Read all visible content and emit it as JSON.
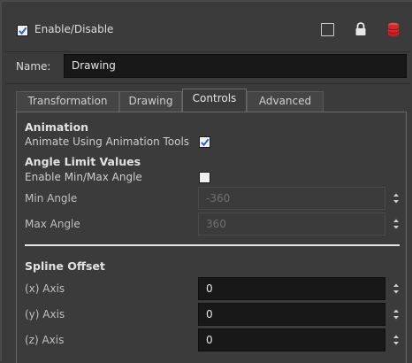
{
  "header": {
    "enable_label": "Enable/Disable",
    "enable_checked": true
  },
  "name": {
    "label": "Name:",
    "value": "Drawing"
  },
  "tabs": [
    {
      "label": "Transformation",
      "active": false
    },
    {
      "label": "Drawing",
      "active": false
    },
    {
      "label": "Controls",
      "active": true
    },
    {
      "label": "Advanced",
      "active": false
    }
  ],
  "controls": {
    "animation_title": "Animation",
    "animate_tools_label": "Animate Using Animation Tools",
    "animate_tools_checked": true,
    "angle_title": "Angle Limit Values",
    "enable_minmax_label": "Enable Min/Max Angle",
    "enable_minmax_checked": false,
    "min_angle_label": "Min Angle",
    "min_angle_value": "-360",
    "max_angle_label": "Max Angle",
    "max_angle_value": "360",
    "spline_title": "Spline Offset",
    "x_axis_label": "(x) Axis",
    "x_axis_value": "0",
    "y_axis_label": "(y) Axis",
    "y_axis_value": "0",
    "z_axis_label": "(z) Axis",
    "z_axis_value": "0"
  },
  "icons": {
    "enable": "checkbox-icon",
    "square": "square-outline-icon",
    "lock": "lock-icon",
    "database": "database-icon",
    "spinner": "spinner-arrows-icon"
  },
  "colors": {
    "background": "#3b3b3b",
    "field_background": "#181818",
    "database_icon": "#e03030",
    "check": "#2f5fd0"
  }
}
